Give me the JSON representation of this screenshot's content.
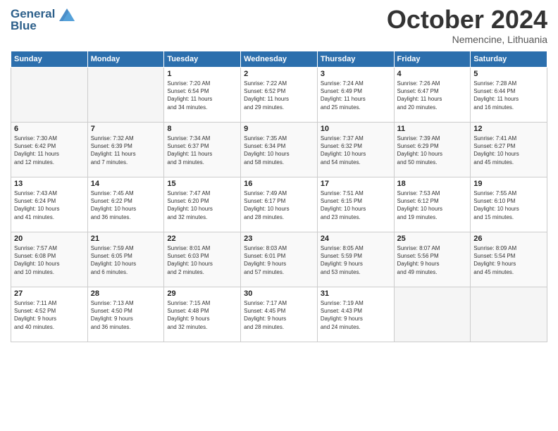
{
  "header": {
    "logo_line1": "General",
    "logo_line2": "Blue",
    "month": "October 2024",
    "location": "Nemencine, Lithuania"
  },
  "days_of_week": [
    "Sunday",
    "Monday",
    "Tuesday",
    "Wednesday",
    "Thursday",
    "Friday",
    "Saturday"
  ],
  "weeks": [
    [
      {
        "day": "",
        "info": ""
      },
      {
        "day": "",
        "info": ""
      },
      {
        "day": "1",
        "info": "Sunrise: 7:20 AM\nSunset: 6:54 PM\nDaylight: 11 hours\nand 34 minutes."
      },
      {
        "day": "2",
        "info": "Sunrise: 7:22 AM\nSunset: 6:52 PM\nDaylight: 11 hours\nand 29 minutes."
      },
      {
        "day": "3",
        "info": "Sunrise: 7:24 AM\nSunset: 6:49 PM\nDaylight: 11 hours\nand 25 minutes."
      },
      {
        "day": "4",
        "info": "Sunrise: 7:26 AM\nSunset: 6:47 PM\nDaylight: 11 hours\nand 20 minutes."
      },
      {
        "day": "5",
        "info": "Sunrise: 7:28 AM\nSunset: 6:44 PM\nDaylight: 11 hours\nand 16 minutes."
      }
    ],
    [
      {
        "day": "6",
        "info": "Sunrise: 7:30 AM\nSunset: 6:42 PM\nDaylight: 11 hours\nand 12 minutes."
      },
      {
        "day": "7",
        "info": "Sunrise: 7:32 AM\nSunset: 6:39 PM\nDaylight: 11 hours\nand 7 minutes."
      },
      {
        "day": "8",
        "info": "Sunrise: 7:34 AM\nSunset: 6:37 PM\nDaylight: 11 hours\nand 3 minutes."
      },
      {
        "day": "9",
        "info": "Sunrise: 7:35 AM\nSunset: 6:34 PM\nDaylight: 10 hours\nand 58 minutes."
      },
      {
        "day": "10",
        "info": "Sunrise: 7:37 AM\nSunset: 6:32 PM\nDaylight: 10 hours\nand 54 minutes."
      },
      {
        "day": "11",
        "info": "Sunrise: 7:39 AM\nSunset: 6:29 PM\nDaylight: 10 hours\nand 50 minutes."
      },
      {
        "day": "12",
        "info": "Sunrise: 7:41 AM\nSunset: 6:27 PM\nDaylight: 10 hours\nand 45 minutes."
      }
    ],
    [
      {
        "day": "13",
        "info": "Sunrise: 7:43 AM\nSunset: 6:24 PM\nDaylight: 10 hours\nand 41 minutes."
      },
      {
        "day": "14",
        "info": "Sunrise: 7:45 AM\nSunset: 6:22 PM\nDaylight: 10 hours\nand 36 minutes."
      },
      {
        "day": "15",
        "info": "Sunrise: 7:47 AM\nSunset: 6:20 PM\nDaylight: 10 hours\nand 32 minutes."
      },
      {
        "day": "16",
        "info": "Sunrise: 7:49 AM\nSunset: 6:17 PM\nDaylight: 10 hours\nand 28 minutes."
      },
      {
        "day": "17",
        "info": "Sunrise: 7:51 AM\nSunset: 6:15 PM\nDaylight: 10 hours\nand 23 minutes."
      },
      {
        "day": "18",
        "info": "Sunrise: 7:53 AM\nSunset: 6:12 PM\nDaylight: 10 hours\nand 19 minutes."
      },
      {
        "day": "19",
        "info": "Sunrise: 7:55 AM\nSunset: 6:10 PM\nDaylight: 10 hours\nand 15 minutes."
      }
    ],
    [
      {
        "day": "20",
        "info": "Sunrise: 7:57 AM\nSunset: 6:08 PM\nDaylight: 10 hours\nand 10 minutes."
      },
      {
        "day": "21",
        "info": "Sunrise: 7:59 AM\nSunset: 6:05 PM\nDaylight: 10 hours\nand 6 minutes."
      },
      {
        "day": "22",
        "info": "Sunrise: 8:01 AM\nSunset: 6:03 PM\nDaylight: 10 hours\nand 2 minutes."
      },
      {
        "day": "23",
        "info": "Sunrise: 8:03 AM\nSunset: 6:01 PM\nDaylight: 9 hours\nand 57 minutes."
      },
      {
        "day": "24",
        "info": "Sunrise: 8:05 AM\nSunset: 5:59 PM\nDaylight: 9 hours\nand 53 minutes."
      },
      {
        "day": "25",
        "info": "Sunrise: 8:07 AM\nSunset: 5:56 PM\nDaylight: 9 hours\nand 49 minutes."
      },
      {
        "day": "26",
        "info": "Sunrise: 8:09 AM\nSunset: 5:54 PM\nDaylight: 9 hours\nand 45 minutes."
      }
    ],
    [
      {
        "day": "27",
        "info": "Sunrise: 7:11 AM\nSunset: 4:52 PM\nDaylight: 9 hours\nand 40 minutes."
      },
      {
        "day": "28",
        "info": "Sunrise: 7:13 AM\nSunset: 4:50 PM\nDaylight: 9 hours\nand 36 minutes."
      },
      {
        "day": "29",
        "info": "Sunrise: 7:15 AM\nSunset: 4:48 PM\nDaylight: 9 hours\nand 32 minutes."
      },
      {
        "day": "30",
        "info": "Sunrise: 7:17 AM\nSunset: 4:45 PM\nDaylight: 9 hours\nand 28 minutes."
      },
      {
        "day": "31",
        "info": "Sunrise: 7:19 AM\nSunset: 4:43 PM\nDaylight: 9 hours\nand 24 minutes."
      },
      {
        "day": "",
        "info": ""
      },
      {
        "day": "",
        "info": ""
      }
    ]
  ]
}
